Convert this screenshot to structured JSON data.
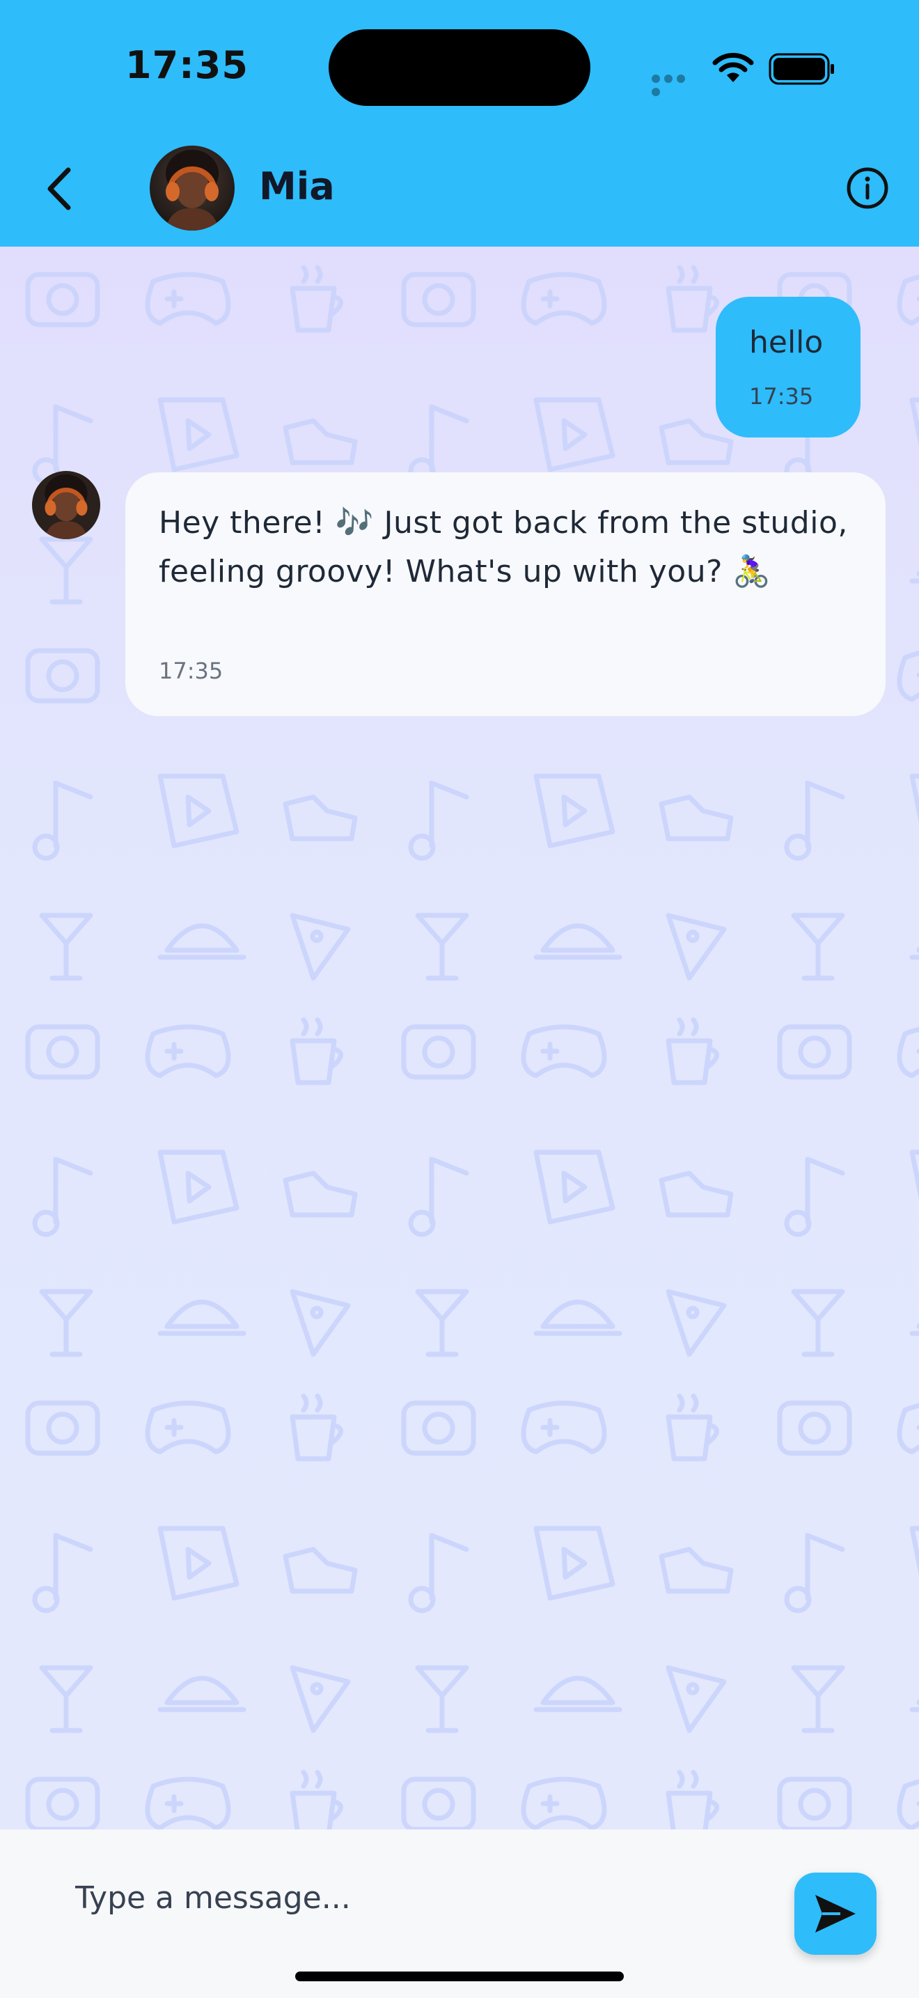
{
  "status_bar": {
    "time": "17:35"
  },
  "header": {
    "contact_name": "Mia",
    "back_icon": "chevron-left-icon",
    "info_icon": "info-circle-icon"
  },
  "messages": [
    {
      "direction": "outgoing",
      "text": "hello",
      "time": "17:35"
    },
    {
      "direction": "incoming",
      "text": "Hey there! 🎶 Just got back from the studio, feeling groovy! What's up with you? 🚴‍♀️",
      "time": "17:35"
    }
  ],
  "composer": {
    "placeholder": "Type a message...",
    "send_icon": "send-icon"
  },
  "colors": {
    "accent": "#2ebcfb",
    "chat_background": "#e2e6fd",
    "incoming_bubble": "#f7f9fc",
    "outgoing_bubble": "#2ebcfb"
  }
}
